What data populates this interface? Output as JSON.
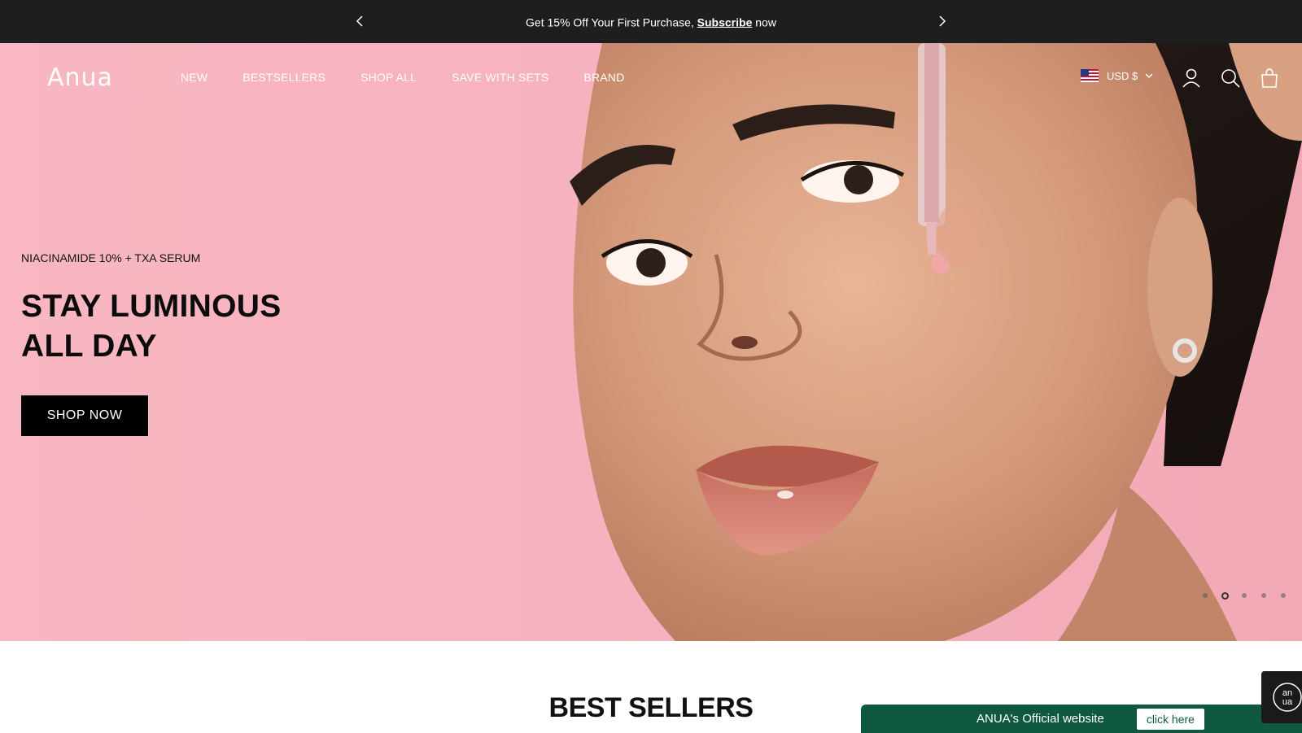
{
  "announcement": {
    "text_before": "Get 15% Off Your First Purchase,",
    "link": "Subscribe",
    "text_after": "now"
  },
  "header": {
    "logo": "Anua",
    "nav": [
      "NEW",
      "BESTSELLERS",
      "SHOP ALL",
      "SAVE WITH SETS",
      "BRAND"
    ],
    "currency": "USD $",
    "icons": [
      "account-icon",
      "search-icon",
      "cart-icon"
    ]
  },
  "hero": {
    "eyebrow": "NIACINAMIDE 10% + TXA SERUM",
    "headline_line1": "STAY LUMINOUS",
    "headline_line2": "ALL DAY",
    "cta": "SHOP NOW",
    "slides_total": 5,
    "active_slide": 2
  },
  "section": {
    "title": "BEST SELLERS"
  },
  "official_banner": {
    "text": "ANUA's Official website",
    "cta": "click here"
  },
  "chat_badge": {
    "label": "an ua"
  },
  "colors": {
    "announcement_bg": "#1e1e1e",
    "hero_bg": "#f7b2bf",
    "cta_bg": "#000000",
    "official_banner_bg": "#0f5a3e"
  }
}
